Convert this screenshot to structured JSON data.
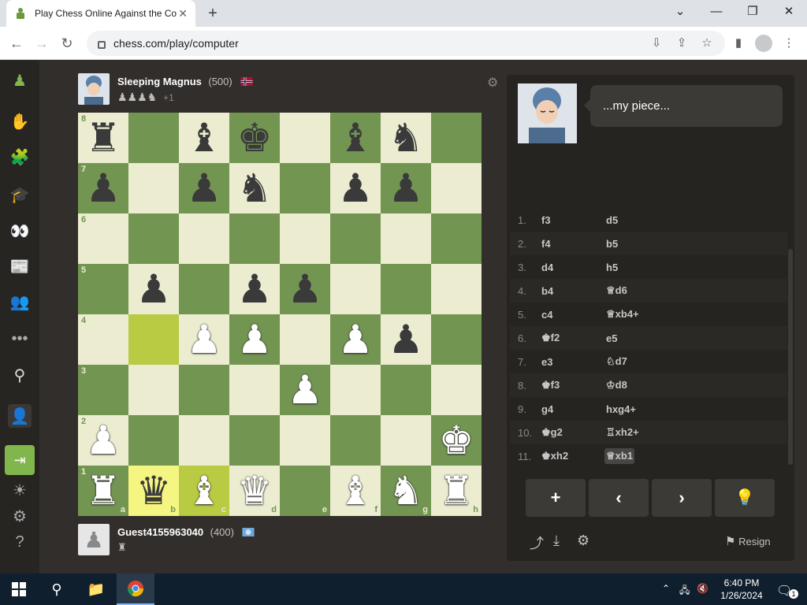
{
  "browser": {
    "tab_title": "Play Chess Online Against the Co",
    "tab_close": "✕",
    "new_tab": "+",
    "url": "chess.com/play/computer",
    "window_controls": [
      "⌄",
      "—",
      "❐",
      "✕"
    ]
  },
  "opponent": {
    "name": "Sleeping Magnus",
    "rating": "(500)",
    "captured": "♟♟♟♞",
    "advantage": "+1",
    "flag": "norway"
  },
  "player": {
    "name": "Guest4155963040",
    "rating": "(400)",
    "captured": "♜",
    "flag": "international"
  },
  "coach": {
    "message": "...my piece..."
  },
  "board": {
    "ranks": [
      "8",
      "7",
      "6",
      "5",
      "4",
      "3",
      "2",
      "1"
    ],
    "files": [
      "a",
      "b",
      "c",
      "d",
      "e",
      "f",
      "g",
      "h"
    ],
    "rows": [
      [
        "bR",
        "",
        "bB",
        "bK",
        "",
        "bB",
        "bN",
        ""
      ],
      [
        "bP",
        "",
        "bP",
        "bN",
        "",
        "bP",
        "bP",
        ""
      ],
      [
        "",
        "",
        "",
        "",
        "",
        "",
        "",
        ""
      ],
      [
        "",
        "bP",
        "",
        "bP",
        "bP",
        "",
        "",
        ""
      ],
      [
        "",
        "",
        "wP",
        "wP",
        "",
        "wP",
        "bP",
        ""
      ],
      [
        "",
        "",
        "",
        "",
        "wP",
        "",
        "",
        ""
      ],
      [
        "wP",
        "",
        "",
        "",
        "",
        "",
        "",
        "wK"
      ],
      [
        "wR",
        "bQ",
        "wB",
        "wQ",
        "",
        "wB",
        "wN",
        "wR"
      ]
    ],
    "highlights": [
      "b4",
      "b1",
      "c1"
    ]
  },
  "moves": [
    {
      "n": "1.",
      "w": "f3",
      "b": "d5"
    },
    {
      "n": "2.",
      "w": "f4",
      "b": "b5"
    },
    {
      "n": "3.",
      "w": "d4",
      "b": "h5"
    },
    {
      "n": "4.",
      "w": "b4",
      "b": "♕d6"
    },
    {
      "n": "5.",
      "w": "c4",
      "b": "♕xb4+"
    },
    {
      "n": "6.",
      "w": "♚f2",
      "b": "e5"
    },
    {
      "n": "7.",
      "w": "e3",
      "b": "♘d7"
    },
    {
      "n": "8.",
      "w": "♚f3",
      "b": "♔d8"
    },
    {
      "n": "9.",
      "w": "g4",
      "b": "hxg4+"
    },
    {
      "n": "10.",
      "w": "♚g2",
      "b": "♖xh2+"
    },
    {
      "n": "11.",
      "w": "♚xh2",
      "b": "♕xb1"
    }
  ],
  "controls": {
    "add": "+",
    "back": "‹",
    "forward": "›",
    "hint": "💡",
    "resign": "Resign"
  },
  "taskbar": {
    "time": "6:40 PM",
    "date": "1/26/2024",
    "notif_count": "1"
  },
  "colors": {
    "light_square": "#ebecd0",
    "dark_square": "#739552",
    "accent": "#81b64c"
  }
}
